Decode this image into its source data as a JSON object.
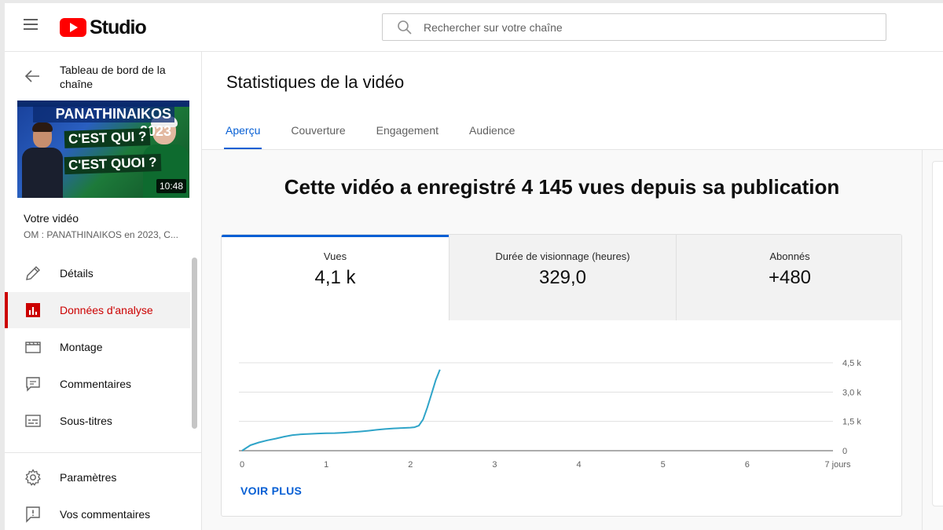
{
  "header": {
    "logo_text": "Studio",
    "search_placeholder": "Rechercher sur votre chaîne"
  },
  "sidebar": {
    "back_label": "Tableau de bord de la chaîne",
    "thumbnail": {
      "banner": "PANATHINAIKOS 2023",
      "line1": "C'EST QUI ?",
      "line2": "C'EST QUOI ?",
      "duration": "10:48"
    },
    "your_video_label": "Votre vidéo",
    "video_title": "OM : PANATHINAIKOS en 2023, C...",
    "items": [
      {
        "label": "Détails",
        "icon": "pencil-icon"
      },
      {
        "label": "Données d'analyse",
        "icon": "analytics-icon",
        "active": true
      },
      {
        "label": "Montage",
        "icon": "clapperboard-icon"
      },
      {
        "label": "Commentaires",
        "icon": "comment-icon"
      },
      {
        "label": "Sous-titres",
        "icon": "subtitles-icon"
      }
    ],
    "bottom_items": [
      {
        "label": "Paramètres",
        "icon": "gear-icon"
      },
      {
        "label": "Vos commentaires",
        "icon": "feedback-icon"
      }
    ]
  },
  "main": {
    "page_title": "Statistiques de la vidéo",
    "tabs": [
      {
        "label": "Aperçu",
        "active": true
      },
      {
        "label": "Couverture"
      },
      {
        "label": "Engagement"
      },
      {
        "label": "Audience"
      }
    ],
    "headline": "Cette vidéo a enregistré 4 145 vues depuis sa publication",
    "metrics": [
      {
        "label": "Vues",
        "value": "4,1 k"
      },
      {
        "label": "Durée de visionnage (heures)",
        "value": "329,0"
      },
      {
        "label": "Abonnés",
        "value": "+480"
      }
    ],
    "see_more": "VOIR PLUS"
  },
  "colors": {
    "accent_blue": "#065fd4",
    "active_red": "#cc0000",
    "line_color": "#2fa4c8",
    "youtube_red": "#ff0000"
  },
  "chart_data": {
    "type": "line",
    "x_tick_labels": [
      "0",
      "1",
      "2",
      "3",
      "4",
      "5",
      "6",
      "7 jours"
    ],
    "y_tick_labels": [
      "0",
      "1,5 k",
      "3,0 k",
      "4,5 k"
    ],
    "y_ticks": [
      0,
      1500,
      3000,
      4500
    ],
    "xlim": [
      0,
      7
    ],
    "ylim": [
      0,
      4500
    ],
    "grid": true,
    "y_axis_side": "right",
    "series": [
      {
        "x": [
          0,
          0.1,
          0.2,
          0.3,
          0.4,
          0.5,
          0.6,
          0.7,
          0.8,
          0.9,
          1.0,
          1.1,
          1.2,
          1.3,
          1.4,
          1.5,
          1.6,
          1.7,
          1.8,
          1.9,
          2.0,
          2.05,
          2.1,
          2.15,
          2.2,
          2.25,
          2.3,
          2.35
        ],
        "y": [
          0,
          280,
          420,
          530,
          620,
          720,
          800,
          840,
          860,
          880,
          890,
          900,
          920,
          950,
          980,
          1020,
          1070,
          1110,
          1140,
          1160,
          1180,
          1200,
          1280,
          1600,
          2200,
          2900,
          3600,
          4145
        ]
      }
    ]
  }
}
